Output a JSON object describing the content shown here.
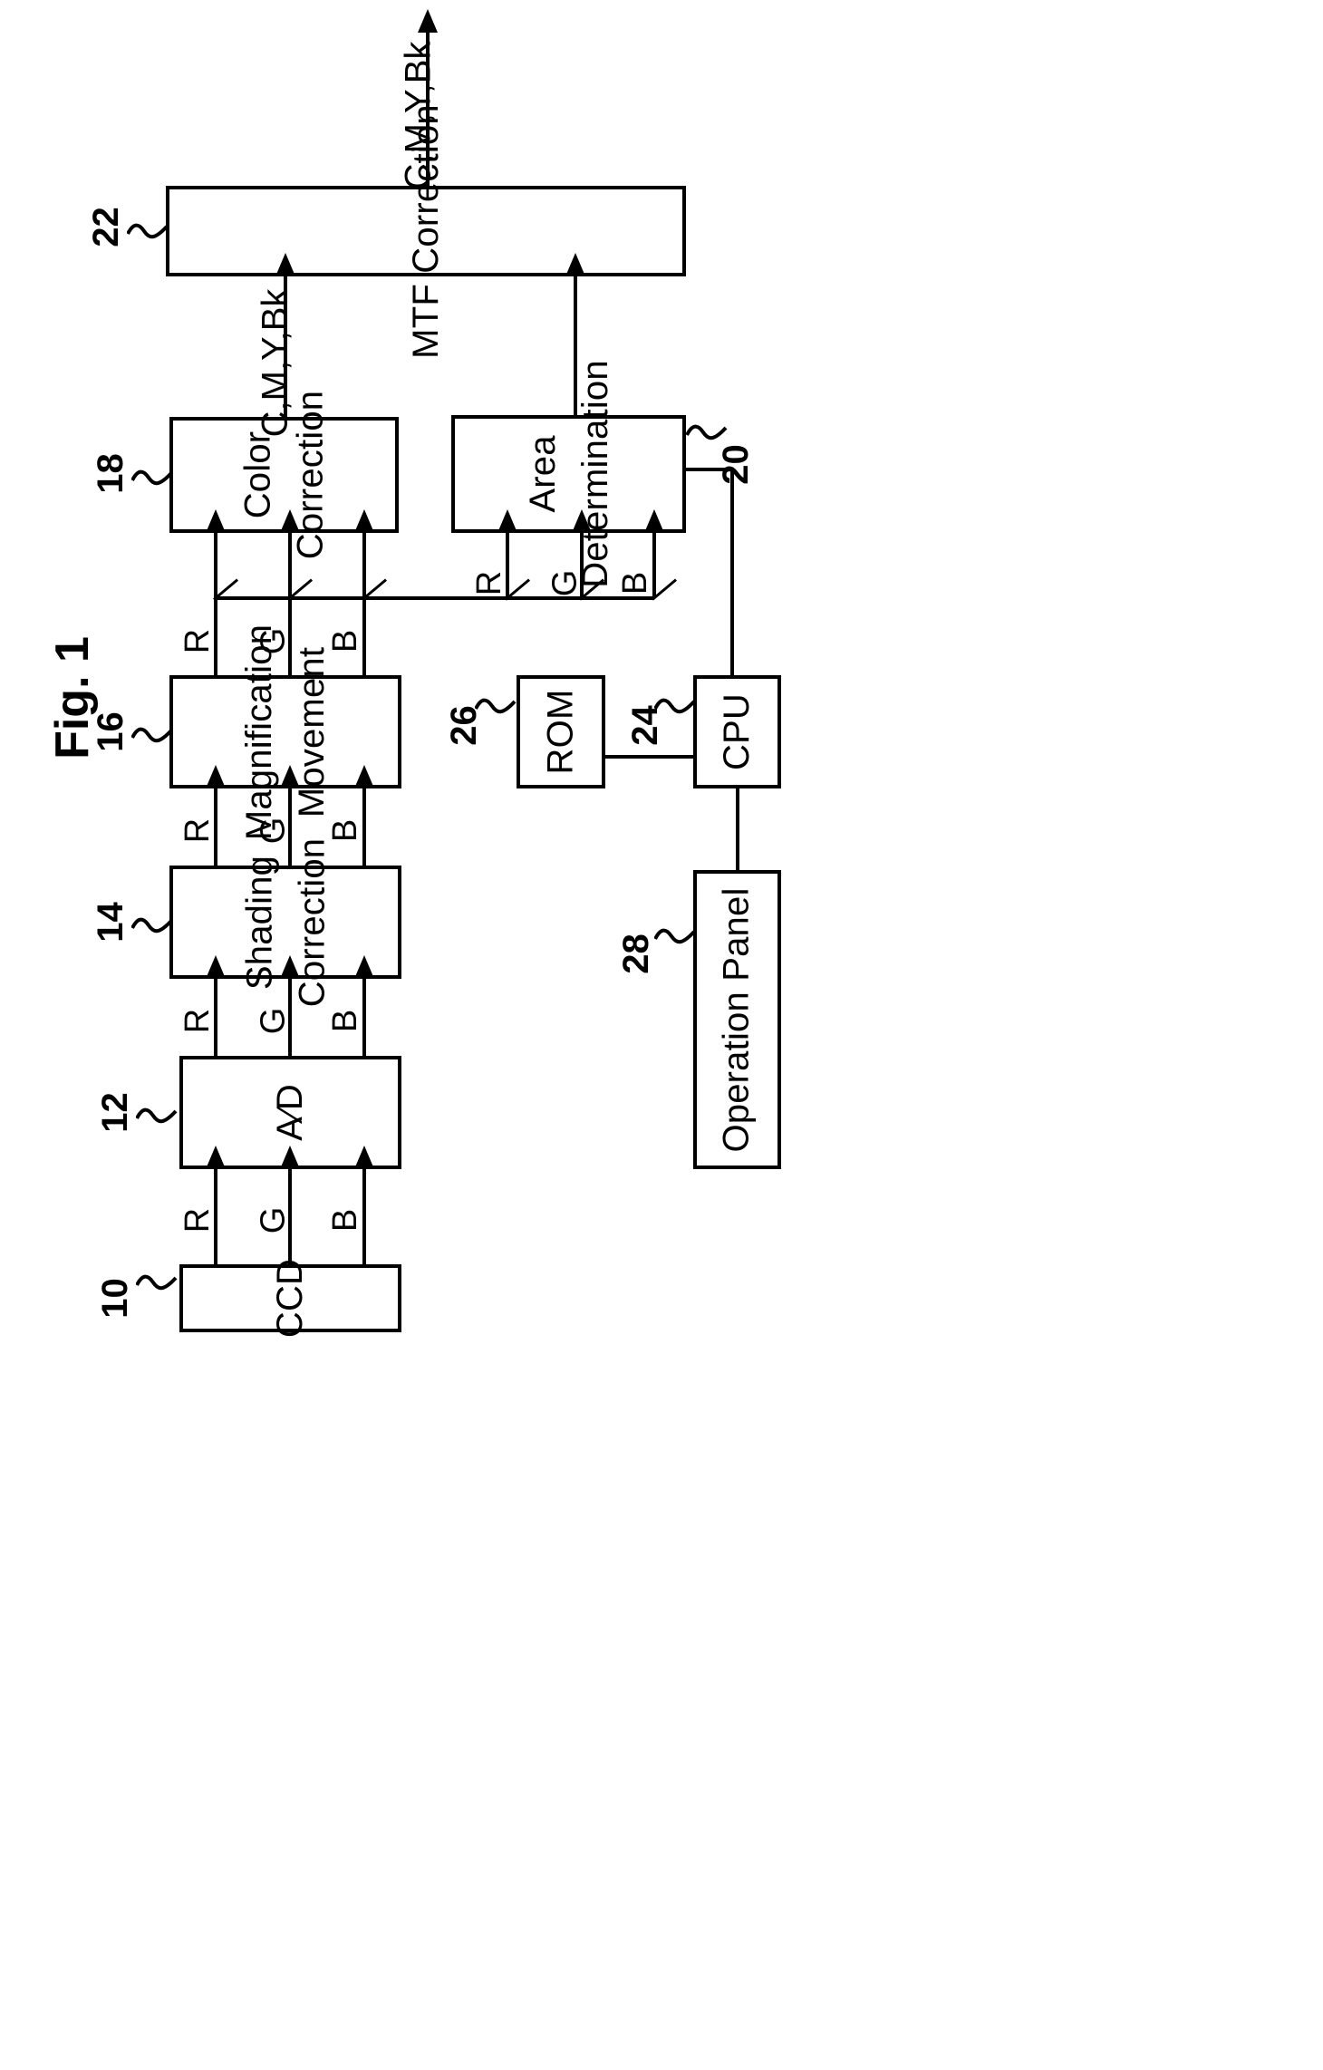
{
  "figure": {
    "title": "Fig. 1",
    "orientation": "rotated-90-ccw"
  },
  "blocks": [
    {
      "id": "ccd",
      "ref": "10",
      "label": "CCD"
    },
    {
      "id": "ad",
      "ref": "12",
      "label": "A∕D"
    },
    {
      "id": "shading",
      "ref": "14",
      "label_line1": "Shading",
      "label_line2": "Correction"
    },
    {
      "id": "magnification",
      "ref": "16",
      "label_line1": "Magnification",
      "label_line2": "Movement"
    },
    {
      "id": "color",
      "ref": "18",
      "label_line1": "Color",
      "label_line2": "Correction"
    },
    {
      "id": "area",
      "ref": "20",
      "label_line1": "Area",
      "label_line2": "Determination"
    },
    {
      "id": "mtf",
      "ref": "22",
      "label": "MTF  Correction"
    },
    {
      "id": "cpu",
      "ref": "24",
      "label": "CPU"
    },
    {
      "id": "rom",
      "ref": "26",
      "label": "ROM"
    },
    {
      "id": "panel",
      "ref": "28",
      "label": "Operation  Panel"
    }
  ],
  "signals": {
    "r": "R",
    "g": "G",
    "b": "B",
    "cmybk": "C,M,Y,Bk"
  },
  "signal_labels": {
    "ccd_to_ad": [
      "R",
      "G",
      "B"
    ],
    "ad_to_shading": [
      "R",
      "G",
      "B"
    ],
    "shading_to_magn": [
      "R",
      "G",
      "B"
    ],
    "magn_to_color": [
      "R",
      "G",
      "B"
    ],
    "magn_to_area": [
      "R",
      "G",
      "B"
    ],
    "color_to_mtf": "C,M,Y,Bk",
    "mtf_output": "C,M,Y,Bk"
  },
  "colors": {
    "ink": "#000000",
    "paper": "#ffffff"
  }
}
